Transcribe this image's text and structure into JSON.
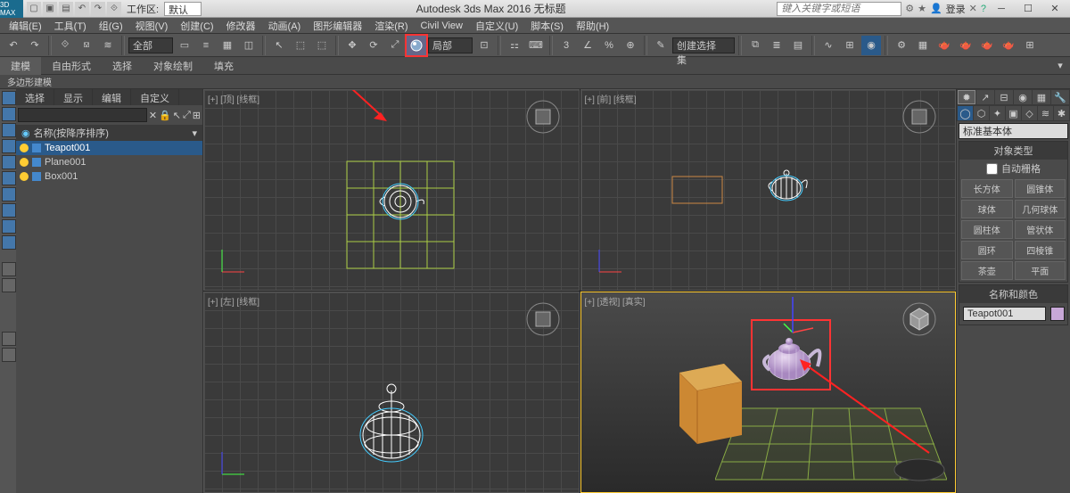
{
  "app": {
    "title": "Autodesk 3ds Max 2016    无标题",
    "icon_text": "3D\nMAX"
  },
  "qat": {
    "workspace_label": "工作区:",
    "workspace_value": "默认"
  },
  "search": {
    "placeholder": "键入关键字或短语"
  },
  "login": {
    "label": "登录"
  },
  "menu": [
    "编辑(E)",
    "工具(T)",
    "组(G)",
    "视图(V)",
    "创建(C)",
    "修改器",
    "动画(A)",
    "图形编辑器",
    "渲染(R)",
    "Civil View",
    "自定义(U)",
    "脚本(S)",
    "帮助(H)"
  ],
  "toolbar": {
    "combo1": "全部",
    "combo2": "局部",
    "combo3": "创建选择集"
  },
  "ribbon": {
    "tabs": [
      "建模",
      "自由形式",
      "选择",
      "对象绘制",
      "填充"
    ],
    "sub": "多边形建模"
  },
  "scene_panel": {
    "tabs": [
      "选择",
      "显示",
      "编辑",
      "自定义"
    ],
    "header": "名称(按降序排序)",
    "items": [
      {
        "name": "Teapot001",
        "selected": true
      },
      {
        "name": "Plane001",
        "selected": false
      },
      {
        "name": "Box001",
        "selected": false
      }
    ]
  },
  "viewports": {
    "tl": "[+] [顶] [线框]",
    "tr": "[+] [前] [线框]",
    "bl": "[+] [左] [线框]",
    "br": "[+] [透视] [真实]"
  },
  "cmd": {
    "category": "标准基本体",
    "rollout1_title": "对象类型",
    "autogrid": "自动栅格",
    "buttons": [
      "长方体",
      "圆锥体",
      "球体",
      "几何球体",
      "圆柱体",
      "管状体",
      "圆环",
      "四棱锥",
      "茶壶",
      "平面"
    ],
    "rollout2_title": "名称和颜色",
    "name_value": "Teapot001"
  }
}
